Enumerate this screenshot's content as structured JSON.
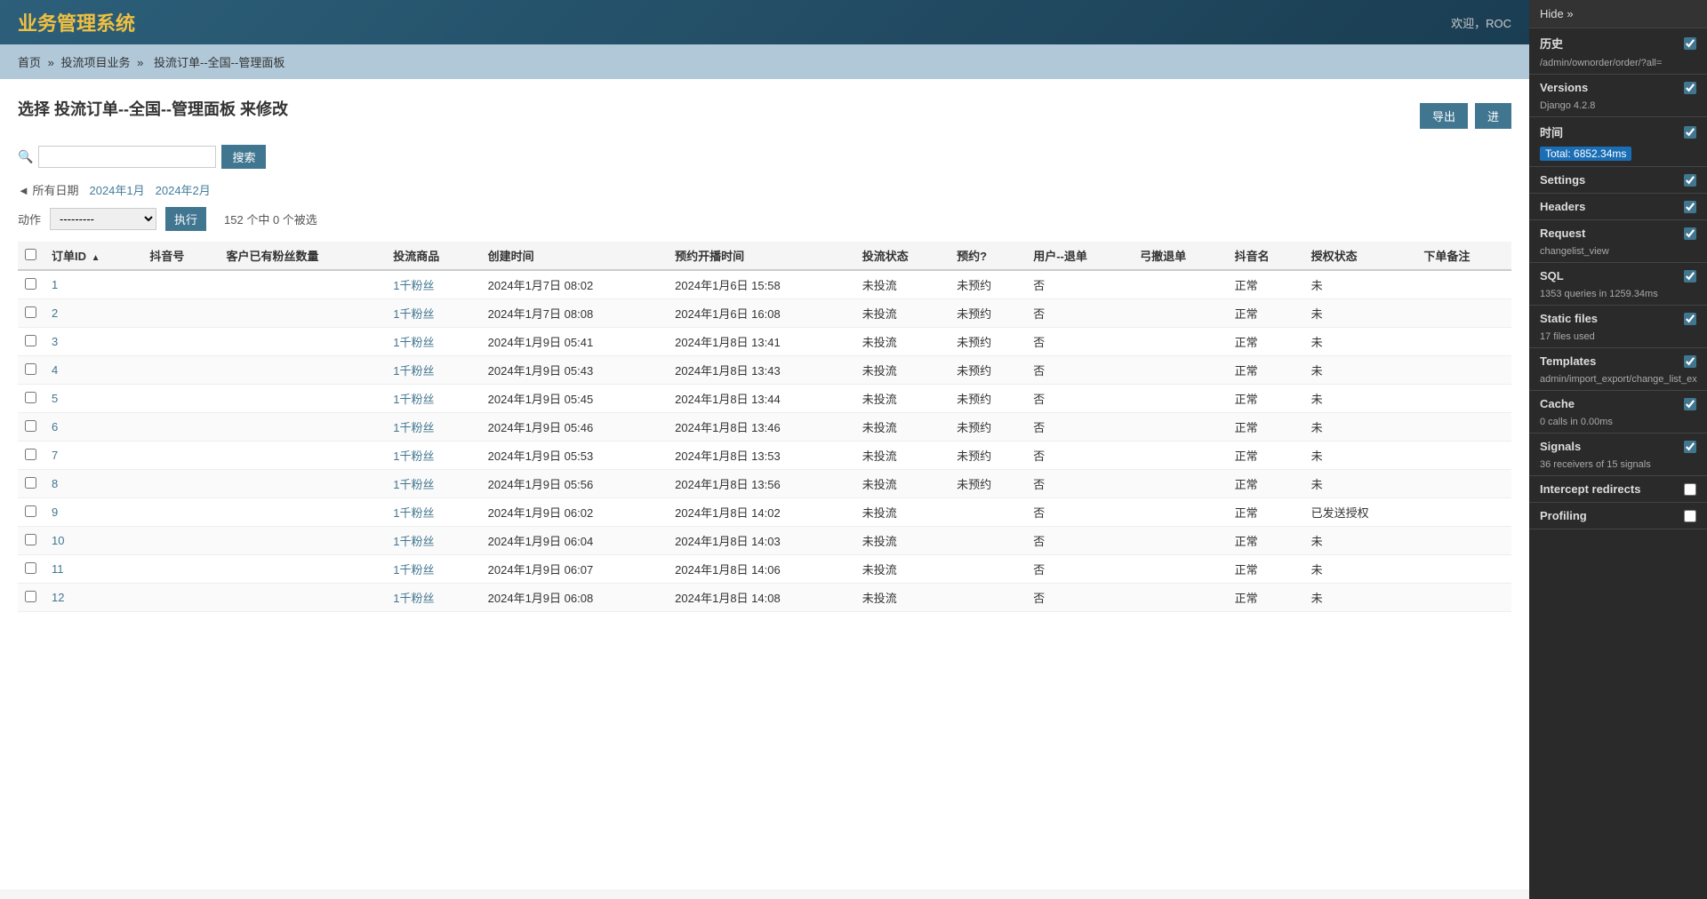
{
  "app": {
    "title": "业务管理系统",
    "welcome": "欢迎，ROC"
  },
  "breadcrumb": {
    "home": "首页",
    "sep1": "»",
    "section": "投流项目业务",
    "sep2": "»",
    "page": "投流订单--全国--管理面板"
  },
  "page": {
    "title": "选择 投流订单--全国--管理面板 来修改",
    "export_btn": "导出",
    "import_btn": "进",
    "search_placeholder": "",
    "search_btn": "搜索"
  },
  "date_filter": {
    "label": "◄ 所有日期",
    "option1": "2024年1月",
    "option2": "2024年2月"
  },
  "toolbar": {
    "action_label": "动作",
    "action_placeholder": "---------",
    "execute_btn": "执行",
    "selected_info": "152 个中 0 个被选"
  },
  "table": {
    "columns": [
      "订单ID",
      "抖音号",
      "客户已有粉丝数量",
      "投流商品",
      "创建时间",
      "预约开播时间",
      "投流状态",
      "预约?",
      "用户--退单",
      "弓撤退单",
      "抖音名",
      "授权状态",
      "下单备注"
    ],
    "rows": [
      {
        "id": "1",
        "douyin_id": "",
        "fans": "",
        "product": "1千粉丝",
        "created": "2024年1月7日 08:02",
        "scheduled": "2024年1月6日 15:58",
        "status": "未投流",
        "booked": "未预约",
        "user_refund": "否",
        "refund": "",
        "name": "正常",
        "auth_status": "未",
        "note": ""
      },
      {
        "id": "2",
        "douyin_id": "",
        "fans": "",
        "product": "1千粉丝",
        "created": "2024年1月7日 08:08",
        "scheduled": "2024年1月6日 16:08",
        "status": "未投流",
        "booked": "未预约",
        "user_refund": "否",
        "refund": "",
        "name": "正常",
        "auth_status": "未",
        "note": ""
      },
      {
        "id": "3",
        "douyin_id": "",
        "fans": "",
        "product": "1千粉丝",
        "created": "2024年1月9日 05:41",
        "scheduled": "2024年1月8日 13:41",
        "status": "未投流",
        "booked": "未预约",
        "user_refund": "否",
        "refund": "",
        "name": "正常",
        "auth_status": "未",
        "note": ""
      },
      {
        "id": "4",
        "douyin_id": "",
        "fans": "",
        "product": "1千粉丝",
        "created": "2024年1月9日 05:43",
        "scheduled": "2024年1月8日 13:43",
        "status": "未投流",
        "booked": "未预约",
        "user_refund": "否",
        "refund": "",
        "name": "正常",
        "auth_status": "未",
        "note": ""
      },
      {
        "id": "5",
        "douyin_id": "",
        "fans": "",
        "product": "1千粉丝",
        "created": "2024年1月9日 05:45",
        "scheduled": "2024年1月8日 13:44",
        "status": "未投流",
        "booked": "未预约",
        "user_refund": "否",
        "refund": "",
        "name": "正常",
        "auth_status": "未",
        "note": ""
      },
      {
        "id": "6",
        "douyin_id": "",
        "fans": "",
        "product": "1千粉丝",
        "created": "2024年1月9日 05:46",
        "scheduled": "2024年1月8日 13:46",
        "status": "未投流",
        "booked": "未预约",
        "user_refund": "否",
        "refund": "",
        "name": "正常",
        "auth_status": "未",
        "note": ""
      },
      {
        "id": "7",
        "douyin_id": "",
        "fans": "",
        "product": "1千粉丝",
        "created": "2024年1月9日 05:53",
        "scheduled": "2024年1月8日 13:53",
        "status": "未投流",
        "booked": "未预约",
        "user_refund": "否",
        "refund": "",
        "name": "正常",
        "auth_status": "未",
        "note": ""
      },
      {
        "id": "8",
        "douyin_id": "",
        "fans": "",
        "product": "1千粉丝",
        "created": "2024年1月9日 05:56",
        "scheduled": "2024年1月8日 13:56",
        "status": "未投流",
        "booked": "未预约",
        "user_refund": "否",
        "refund": "",
        "name": "正常",
        "auth_status": "未",
        "note": ""
      },
      {
        "id": "9",
        "douyin_id": "",
        "fans": "",
        "product": "1千粉丝",
        "created": "2024年1月9日 06:02",
        "scheduled": "2024年1月8日 14:02",
        "status": "未投流",
        "booked": "",
        "user_refund": "否",
        "refund": "",
        "name": "正常",
        "auth_status": "已发送授权",
        "note": ""
      },
      {
        "id": "10",
        "douyin_id": "",
        "fans": "",
        "product": "1千粉丝",
        "created": "2024年1月9日 06:04",
        "scheduled": "2024年1月8日 14:03",
        "status": "未投流",
        "booked": "",
        "user_refund": "否",
        "refund": "",
        "name": "正常",
        "auth_status": "未",
        "note": ""
      },
      {
        "id": "11",
        "douyin_id": "",
        "fans": "",
        "product": "1千粉丝",
        "created": "2024年1月9日 06:07",
        "scheduled": "2024年1月8日 14:06",
        "status": "未投流",
        "booked": "",
        "user_refund": "否",
        "refund": "",
        "name": "正常",
        "auth_status": "未",
        "note": ""
      },
      {
        "id": "12",
        "douyin_id": "",
        "fans": "",
        "product": "1千粉丝",
        "created": "2024年1月9日 06:08",
        "scheduled": "2024年1月8日 14:08",
        "status": "未投流",
        "booked": "",
        "user_refund": "否",
        "refund": "",
        "name": "正常",
        "auth_status": "未",
        "note": ""
      }
    ]
  },
  "debug_toolbar": {
    "hide_label": "Hide »",
    "sections": [
      {
        "key": "history",
        "title": "历史",
        "sub": "/admin/ownorder/order/?all=",
        "checked": true,
        "highlight": null
      },
      {
        "key": "versions",
        "title": "Versions",
        "sub": "Django 4.2.8",
        "checked": true,
        "highlight": null
      },
      {
        "key": "time",
        "title": "时间",
        "sub": null,
        "checked": true,
        "highlight": "Total: 6852.34ms"
      },
      {
        "key": "settings",
        "title": "Settings",
        "sub": null,
        "checked": true,
        "highlight": null
      },
      {
        "key": "headers",
        "title": "Headers",
        "sub": null,
        "checked": true,
        "highlight": null
      },
      {
        "key": "request",
        "title": "Request",
        "sub": "changelist_view",
        "checked": true,
        "highlight": null
      },
      {
        "key": "sql",
        "title": "SQL",
        "sub": "1353 queries in 1259.34ms",
        "checked": true,
        "highlight": null
      },
      {
        "key": "static_files",
        "title": "Static files",
        "sub": "17 files used",
        "checked": true,
        "highlight": null
      },
      {
        "key": "templates",
        "title": "Templates",
        "sub": "admin/import_export/change_list_ex",
        "checked": true,
        "highlight": null
      },
      {
        "key": "cache",
        "title": "Cache",
        "sub": "0 calls in 0.00ms",
        "checked": true,
        "highlight": null
      },
      {
        "key": "signals",
        "title": "Signals",
        "sub": "36 receivers of 15 signals",
        "checked": true,
        "highlight": null
      },
      {
        "key": "intercept_redirects",
        "title": "Intercept redirects",
        "sub": null,
        "checked": false,
        "highlight": null
      },
      {
        "key": "profiling",
        "title": "Profiling",
        "sub": null,
        "checked": false,
        "highlight": null
      }
    ]
  }
}
